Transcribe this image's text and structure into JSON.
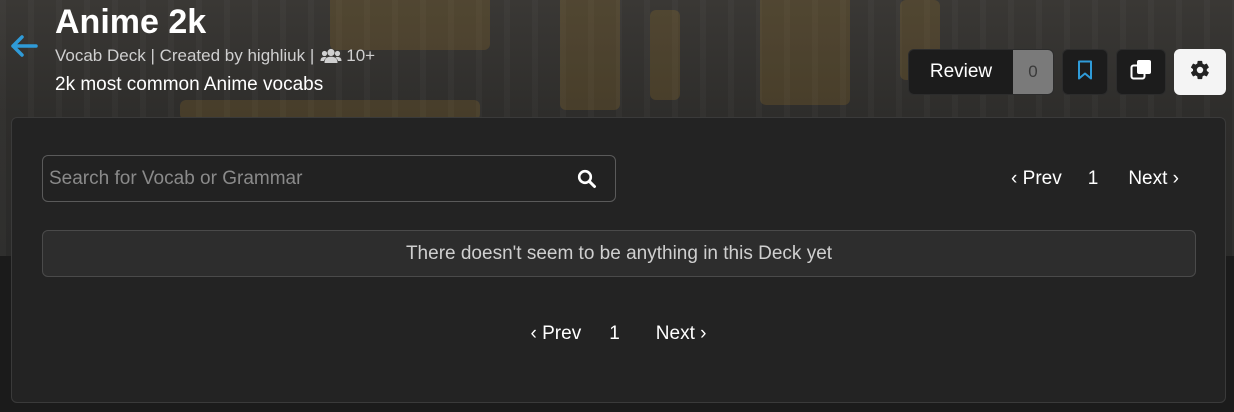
{
  "deck": {
    "title": "Anime 2k",
    "meta_text": "Vocab Deck | Created by highliuk |",
    "users_count": "10+",
    "description": "2k most common Anime vocabs"
  },
  "actions": {
    "review_label": "Review",
    "review_count": "0",
    "bookmark_icon": "bookmark-icon",
    "copy_icon": "copy-icon",
    "settings_icon": "gear-icon"
  },
  "search": {
    "placeholder": "Search for Vocab or Grammar",
    "value": ""
  },
  "pagination": {
    "prev_label": "‹ Prev",
    "page": "1",
    "next_label": "Next ›"
  },
  "empty_message": "There doesn't seem to be anything in this Deck yet",
  "colors": {
    "accent": "#2f9bd8",
    "background": "#1e1e1e",
    "panel": "#232323"
  }
}
